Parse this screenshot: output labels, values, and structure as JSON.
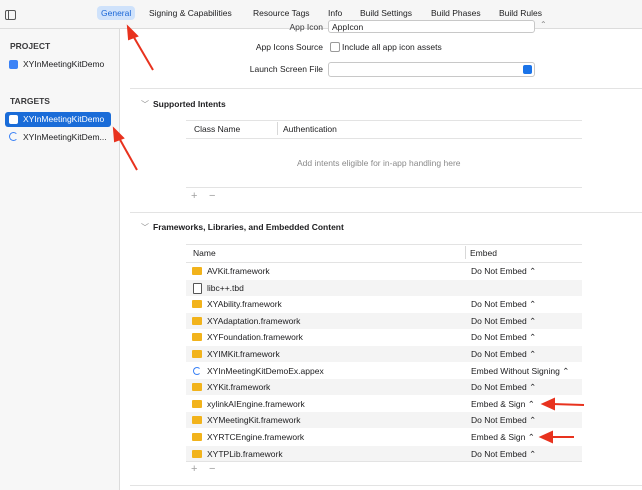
{
  "tabs": [
    "General",
    "Signing & Capabilities",
    "Resource Tags",
    "Info",
    "Build Settings",
    "Build Phases",
    "Build Rules"
  ],
  "sidebar": {
    "project_header": "PROJECT",
    "project_item": "XYInMeetingKitDemo",
    "targets_header": "TARGETS",
    "targets": [
      "XYInMeetingKitDemo",
      "XYInMeetingKitDem..."
    ]
  },
  "app_icons": {
    "app_icon_label": "App Icon",
    "app_icon_value": "AppIcon",
    "source_label": "App Icons Source",
    "source_checkbox": "Include all app icon assets",
    "launch_label": "Launch Screen File"
  },
  "intents": {
    "title": "Supported Intents",
    "col_class": "Class Name",
    "col_auth": "Authentication",
    "empty": "Add intents eligible for in-app handling here"
  },
  "frameworks": {
    "title": "Frameworks, Libraries, and Embedded Content",
    "col_name": "Name",
    "col_embed": "Embed",
    "rows": [
      {
        "name": "AVKit.framework",
        "embed": "Do Not Embed ⌃",
        "icon": "framework-icon"
      },
      {
        "name": "libc++.tbd",
        "embed": "",
        "icon": "tbd-file-icon"
      },
      {
        "name": "XYAbility.framework",
        "embed": "Do Not Embed ⌃",
        "icon": "framework-icon"
      },
      {
        "name": "XYAdaptation.framework",
        "embed": "Do Not Embed ⌃",
        "icon": "framework-icon"
      },
      {
        "name": "XYFoundation.framework",
        "embed": "Do Not Embed ⌃",
        "icon": "framework-icon"
      },
      {
        "name": "XYIMKit.framework",
        "embed": "Do Not Embed ⌃",
        "icon": "framework-icon"
      },
      {
        "name": "XYInMeetingKitDemoEx.appex",
        "embed": "Embed Without Signing ⌃",
        "icon": "extension-icon"
      },
      {
        "name": "XYKit.framework",
        "embed": "Do Not Embed ⌃",
        "icon": "framework-icon"
      },
      {
        "name": "xylinkAIEngine.framework",
        "embed": "Embed & Sign ⌃",
        "icon": "framework-icon"
      },
      {
        "name": "XYMeetingKit.framework",
        "embed": "Do Not Embed ⌃",
        "icon": "framework-icon"
      },
      {
        "name": "XYRTCEngine.framework",
        "embed": "Embed & Sign ⌃",
        "icon": "framework-icon"
      },
      {
        "name": "XYTPLib.framework",
        "embed": "Do Not Embed ⌃",
        "icon": "framework-icon"
      }
    ]
  },
  "colors": {
    "accent": "#1a6cd8",
    "annotation_arrow": "#e8321e",
    "framework_icon": "#f2b31b"
  }
}
